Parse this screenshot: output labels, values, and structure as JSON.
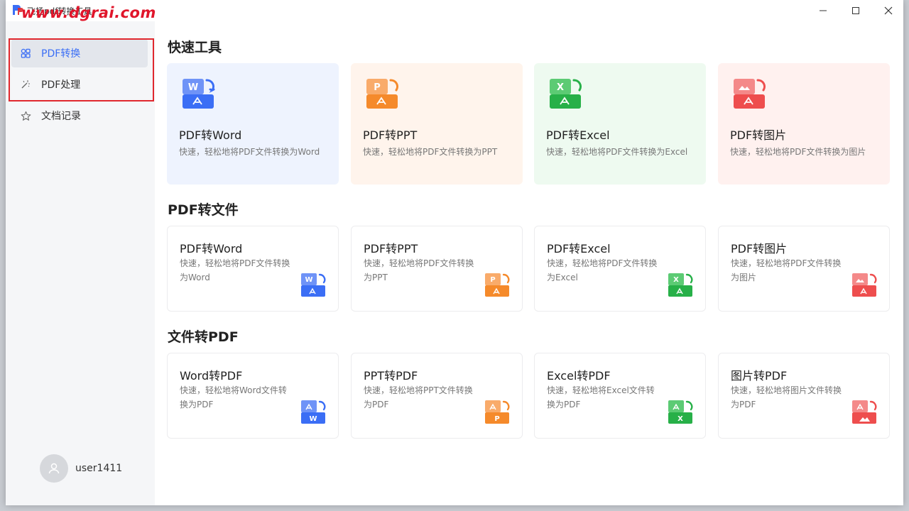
{
  "window": {
    "title": "飞扬pdf转换工具",
    "watermark": "www.dgrai.com",
    "controls": {
      "minimize": "—",
      "maximize": "☐",
      "close": "✕"
    }
  },
  "sidebar": {
    "items": [
      {
        "label": "PDF转换",
        "icon": "grid-icon",
        "active": true
      },
      {
        "label": "PDF处理",
        "icon": "magic-wand-icon",
        "active": false
      },
      {
        "label": "文档记录",
        "icon": "star-icon",
        "active": false
      }
    ],
    "user": {
      "name": "user1411"
    }
  },
  "sections": {
    "quick": {
      "title": "快速工具",
      "cards": [
        {
          "title": "PDF转Word",
          "desc": "快速，轻松地将PDF文件转换为Word",
          "bg": "#eef3fe",
          "color": "#3b6ef5",
          "letter": "W"
        },
        {
          "title": "PDF转PPT",
          "desc": "快速，轻松地将PDF文件转换为PPT",
          "bg": "#fff4ec",
          "color": "#f58a2b",
          "letter": "P"
        },
        {
          "title": "PDF转Excel",
          "desc": "快速，轻松地将PDF文件转换为Excel",
          "bg": "#eefaf0",
          "color": "#27b048",
          "letter": "X"
        },
        {
          "title": "PDF转图片",
          "desc": "快速，轻松地将PDF文件转换为图片",
          "bg": "#fff1ef",
          "color": "#ee4e4e",
          "letter": ""
        }
      ]
    },
    "pdf_to_file": {
      "title": "PDF转文件",
      "cards": [
        {
          "title": "PDF转Word",
          "desc": "快速，轻松地将PDF文件转换为Word"
        },
        {
          "title": "PDF转PPT",
          "desc": "快速，轻松地将PDF文件转换为PPT"
        },
        {
          "title": "PDF转Excel",
          "desc": "快速，轻松地将PDF文件转换为Excel"
        },
        {
          "title": "PDF转图片",
          "desc": "快速，轻松地将PDF文件转换为图片"
        }
      ]
    },
    "file_to_pdf": {
      "title": "文件转PDF",
      "cards": [
        {
          "title": "Word转PDF",
          "desc": "快速，轻松地将Word文件转换为PDF"
        },
        {
          "title": "PPT转PDF",
          "desc": "快速，轻松地将PPT文件转换为PDF"
        },
        {
          "title": "Excel转PDF",
          "desc": "快速，轻松地将Excel文件转换为PDF"
        },
        {
          "title": "图片转PDF",
          "desc": "快速，轻松地将图片文件转换为PDF"
        }
      ]
    }
  },
  "colors": {
    "word": "#3b6ef5",
    "ppt": "#f58a2b",
    "excel": "#27b048",
    "image": "#ee4e4e",
    "accent": "#3b6ef5",
    "highlight": "#e0282e"
  }
}
